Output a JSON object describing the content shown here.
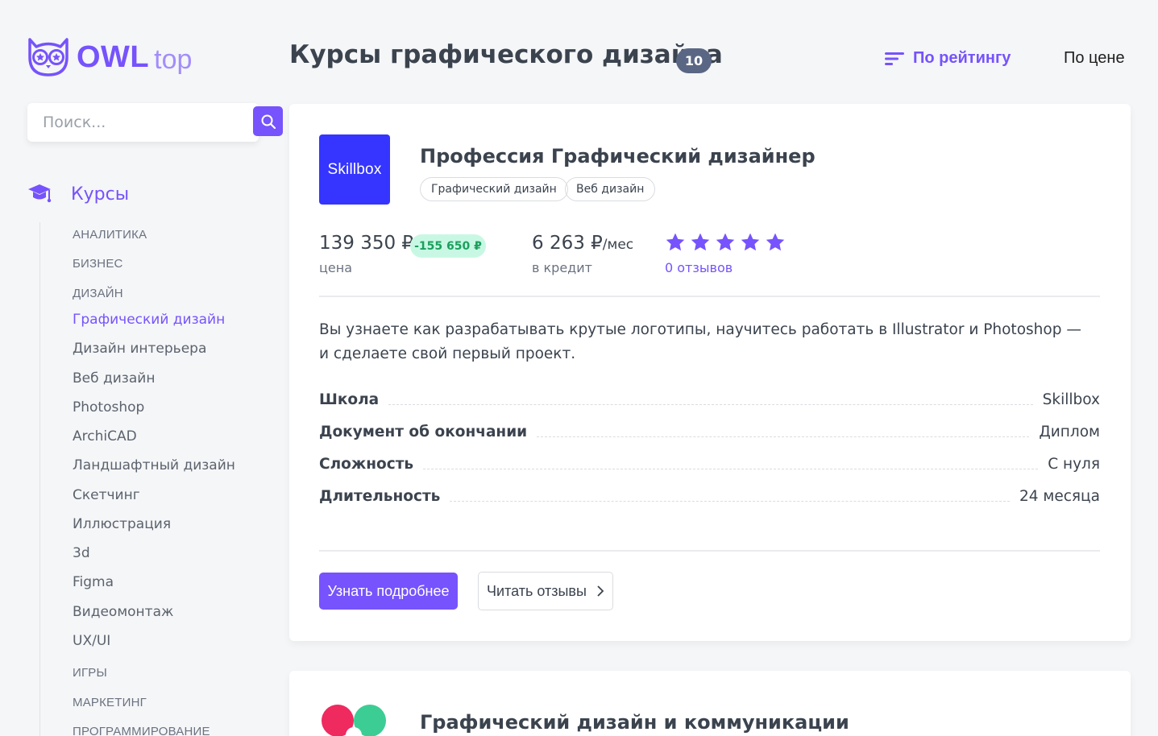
{
  "brand": {
    "logo_icon": "owl-icon",
    "name_bold": "OWL",
    "name_light": "top",
    "accent_color": "#7653fc"
  },
  "search": {
    "placeholder": "Поиск...",
    "value": "",
    "icon": "search-icon"
  },
  "sidebar": {
    "section_icon": "graduation-cap-icon",
    "section_title": "Курсы",
    "items": [
      {
        "label": "АНАЛИТИКА",
        "kind": "category"
      },
      {
        "label": "БИЗНЕС",
        "kind": "category"
      },
      {
        "label": "ДИЗАЙН",
        "kind": "category"
      },
      {
        "label": "Графический дизайн",
        "kind": "sub",
        "active": true
      },
      {
        "label": "Дизайн интерьера",
        "kind": "sub"
      },
      {
        "label": "Веб дизайн",
        "kind": "sub"
      },
      {
        "label": "Photoshop",
        "kind": "sub"
      },
      {
        "label": "ArchiCAD",
        "kind": "sub"
      },
      {
        "label": "Ландшафтный дизайн",
        "kind": "sub"
      },
      {
        "label": "Скетчинг",
        "kind": "sub"
      },
      {
        "label": "Иллюстрация",
        "kind": "sub"
      },
      {
        "label": "3d",
        "kind": "sub"
      },
      {
        "label": "Figma",
        "kind": "sub"
      },
      {
        "label": "Видеомонтаж",
        "kind": "sub"
      },
      {
        "label": "UX/UI",
        "kind": "sub"
      },
      {
        "label": "ИГРЫ",
        "kind": "category"
      },
      {
        "label": "МАРКЕТИНГ",
        "kind": "category"
      },
      {
        "label": "ПРОГРАММИРОВАНИЕ",
        "kind": "category"
      }
    ]
  },
  "header": {
    "title": "Курсы графического дизайна",
    "count": "10",
    "sort_rating": "По рейтингу",
    "sort_price": "По цене"
  },
  "courses": [
    {
      "school_logo_text": "Skillbox",
      "school_logo_color": "#3535ff",
      "title": "Профессия Графический дизайнер",
      "tags": [
        "Графический дизайн",
        "Веб дизайн"
      ],
      "price": "139 350 ₽",
      "discount": "-155 650 ₽",
      "price_caption": "цена",
      "credit_amount": "6 263 ₽",
      "credit_unit": "/мес",
      "credit_caption": "в кредит",
      "rating": 5,
      "reviews": "0 отзывов",
      "description": "Вы узнаете как разрабатывать крутые логотипы, научитесь работать в Illustrator и Photoshop — и сделаете свой первый проект.",
      "info": [
        {
          "label": "Школа",
          "value": "Skillbox"
        },
        {
          "label": "Документ об окончании",
          "value": "Диплом"
        },
        {
          "label": "Сложность",
          "value": "С нуля"
        },
        {
          "label": "Длительность",
          "value": "24 месяца"
        }
      ],
      "more_button": "Узнать подробнее",
      "reviews_button": "Читать отзывы"
    },
    {
      "title": "Графический дизайн и коммуникации",
      "logo_colors": [
        "#ee2a5f",
        "#3ccd95"
      ]
    }
  ]
}
